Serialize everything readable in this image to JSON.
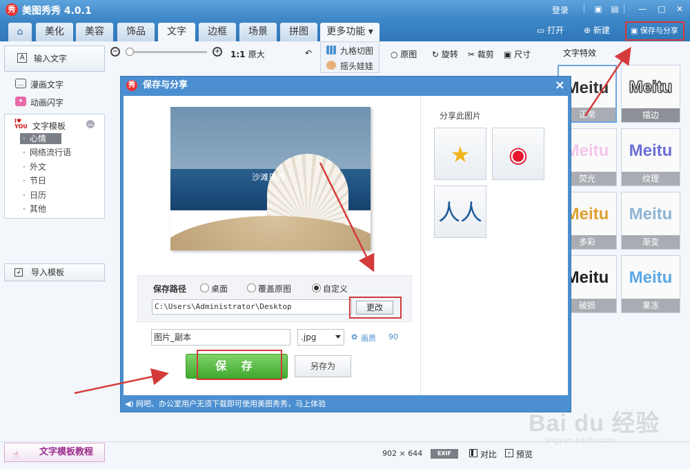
{
  "app": {
    "title": "美图秀秀 4.0.1",
    "logo_char": "秀",
    "login": "登录"
  },
  "nav": {
    "tabs": [
      {
        "label": "美化"
      },
      {
        "label": "美容"
      },
      {
        "label": "饰品"
      },
      {
        "label": "文字"
      },
      {
        "label": "边框"
      },
      {
        "label": "场景"
      },
      {
        "label": "拼图"
      }
    ],
    "more": "更多功能",
    "open": "打开",
    "new": "新建",
    "share": "保存与分享"
  },
  "more_dropdown": {
    "items": [
      "九格切图",
      "摇头娃娃"
    ]
  },
  "toolbar": {
    "zoom_ratio": "1:1",
    "original_size": "原大",
    "original": "原图",
    "rotate": "旋转",
    "crop": "裁剪",
    "resize": "尺寸"
  },
  "left_panel": {
    "input_text": "输入文字",
    "comic_text": "漫画文字",
    "animated_text": "动画闪字",
    "template_head": "文字模板",
    "template_items": [
      "心情",
      "网络流行语",
      "外文",
      "节日",
      "日历",
      "其他"
    ],
    "import_template": "导入模板"
  },
  "effects": {
    "title": "文字特效",
    "word": "Meitu",
    "tiles": [
      {
        "label": "正常",
        "color": "#333333"
      },
      {
        "label": "描边",
        "color": "#111111"
      },
      {
        "label": "荧光",
        "color": "#e89ad8"
      },
      {
        "label": "纹理",
        "color": "#6b6fd6"
      },
      {
        "label": "多彩",
        "color": "#e0a030"
      },
      {
        "label": "渐变",
        "color": "#8fb4d4"
      },
      {
        "label": "破损",
        "color": "#222222"
      },
      {
        "label": "果冻",
        "color": "#5aa8e8"
      }
    ]
  },
  "dialog": {
    "title": "保存与分享",
    "close": "×",
    "preview_text": "沙滩贝壳",
    "path_label": "保存路径",
    "options": [
      "桌面",
      "覆盖原图",
      "自定义"
    ],
    "selected_option": "自定义",
    "path_value": "C:\\Users\\Administrator\\Desktop",
    "change_button": "更改",
    "filename": "图片_副本",
    "extension": ".jpg",
    "quality_label": "画质",
    "quality_value": "90",
    "save_button": "保 存",
    "save_as_button": "另存为",
    "share_label": "分享此图片",
    "footer": "网吧、办公室用户无须下载即可使用美图秀秀，马上体验"
  },
  "status": {
    "tutorial": "文字模板教程",
    "width": "902",
    "times": "×",
    "height": "644",
    "exif": "EXIF",
    "compare": "对比",
    "preview": "预览"
  },
  "watermark": {
    "brand": "Bai du 经验",
    "url": "jingyan.baidu.com"
  },
  "colors": {
    "accent_red": "#d43a3a",
    "title_blue": "#4b8fd0",
    "save_green": "#3fa92e"
  }
}
